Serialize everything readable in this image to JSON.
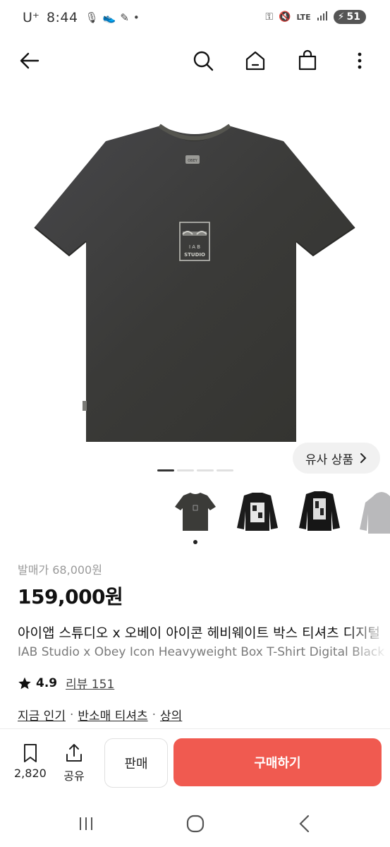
{
  "status_bar": {
    "carrier": "U⁺",
    "time": "8:44",
    "network": "LTE",
    "battery": "51"
  },
  "top_nav": {
    "icons": [
      "back-arrow-icon",
      "search-icon",
      "home-icon",
      "shopping-bag-icon",
      "more-vertical-icon"
    ]
  },
  "gallery": {
    "similar_label": "유사 상품",
    "page_count": 4,
    "active_page": 1,
    "thumbnails": [
      "t-shirt-front",
      "jacket-back",
      "jacket-back-2",
      "hoodie-gray"
    ]
  },
  "product": {
    "original_price": "발매가 68,000원",
    "price": "159,000원",
    "title_ko": "아이앱 스튜디오 x 오베이 아이콘 헤비웨이트 박스 티셔츠 디지털",
    "title_en": "IAB Studio x Obey Icon Heavyweight Box T-Shirt Digital Black",
    "rating": "4.9",
    "review_label": "리뷰 151",
    "categories": [
      "지금 인기",
      "반소매 티셔츠",
      "상의"
    ],
    "category_sep": "·"
  },
  "action_bar": {
    "bookmark_count": "2,820",
    "share_label": "공유",
    "sell_label": "판매",
    "buy_label": "구매하기",
    "buy_color": "#f05a50"
  },
  "shirt": {
    "logo_top": "OBEY",
    "logo_line1": "I A B",
    "logo_line2": "STUDIO",
    "color": "#3b3b38"
  }
}
